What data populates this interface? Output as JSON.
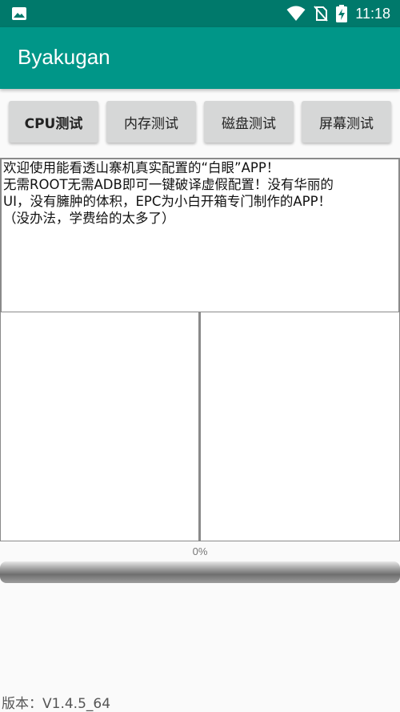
{
  "status_bar": {
    "time": "11:18",
    "icons": [
      "image-notification-icon",
      "wifi-icon",
      "no-sim-icon",
      "battery-charging-icon"
    ]
  },
  "app_bar": {
    "title": "Byakugan",
    "color": "#009688"
  },
  "test_buttons": [
    {
      "label": "CPU测试"
    },
    {
      "label": "内存测试"
    },
    {
      "label": "磁盘测试"
    },
    {
      "label": "屏幕测试"
    }
  ],
  "info_text": {
    "lines": [
      "欢迎使用能看透山寨机真实配置的“白眼”APP！",
      "无需ROOT无需ADB即可一键破译虚假配置！没有华丽的",
      "UI，没有臃肿的体积，EPC为小白开箱专门制作的APP！",
      "（没办法，学费给的太多了）"
    ]
  },
  "progress": {
    "text": "0%",
    "value": 0
  },
  "footer": {
    "version": "版本：V1.4.5_64"
  }
}
